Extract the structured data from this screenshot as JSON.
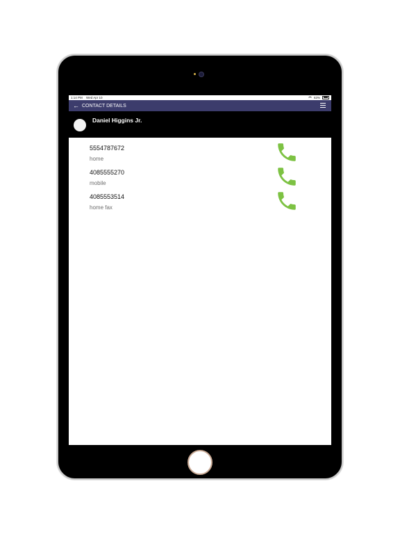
{
  "status_bar": {
    "time": "1:14 PM",
    "date": "Wed Apr 10",
    "battery": "63%"
  },
  "nav": {
    "title": "CONTACT DETAILS"
  },
  "contact": {
    "name": "Daniel Higgins Jr."
  },
  "phones": [
    {
      "number": "5554787672",
      "type": "home"
    },
    {
      "number": "4085555270",
      "type": "mobile"
    },
    {
      "number": "4085553514",
      "type": "home fax"
    }
  ],
  "colors": {
    "nav_bar": "#3c3c6c",
    "call_icon": "#7dc243",
    "device": "#000000"
  },
  "icons": {
    "back": "arrow-left-icon",
    "menu": "hamburger-menu-icon",
    "call": "phone-icon"
  }
}
